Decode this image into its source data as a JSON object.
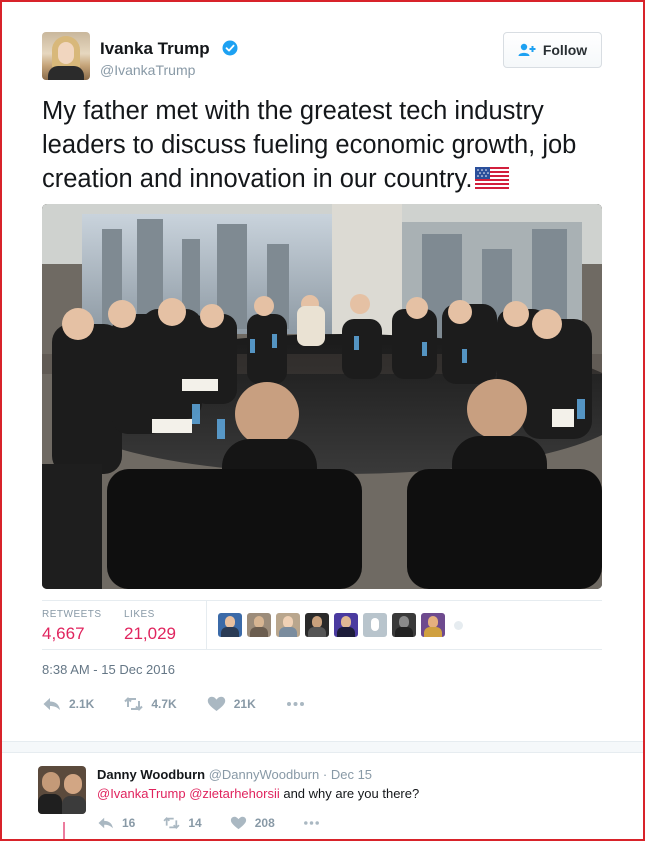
{
  "tweet": {
    "author_name": "Ivanka Trump",
    "author_handle": "@IvankaTrump",
    "follow_label": "Follow",
    "text": "My father met with the greatest tech industry leaders to discuss fueling economic growth, job creation and innovation in our country.",
    "flag_icon": "us-flag-icon",
    "stats": {
      "retweets_label": "RETWEETS",
      "retweets_value": "4,667",
      "likes_label": "LIKES",
      "likes_value": "21,029"
    },
    "timestamp": "8:38 AM - 15 Dec 2016",
    "actions": {
      "reply_count": "2.1K",
      "retweet_count": "4.7K",
      "like_count": "21K"
    }
  },
  "reply": {
    "author_name": "Danny Woodburn",
    "author_handle": "@DannyWoodburn",
    "separator": "·",
    "date": "Dec 15",
    "mention_1": "@IvankaTrump",
    "mention_2": "@zietarhehorsii",
    "text": "and why are you there?",
    "actions": {
      "reply_count": "16",
      "retweet_count": "14",
      "like_count": "208"
    }
  },
  "colors": {
    "accent": "#e0245e",
    "muted": "#8899a6",
    "verified": "#1da1f2",
    "frame": "#d8232a"
  }
}
